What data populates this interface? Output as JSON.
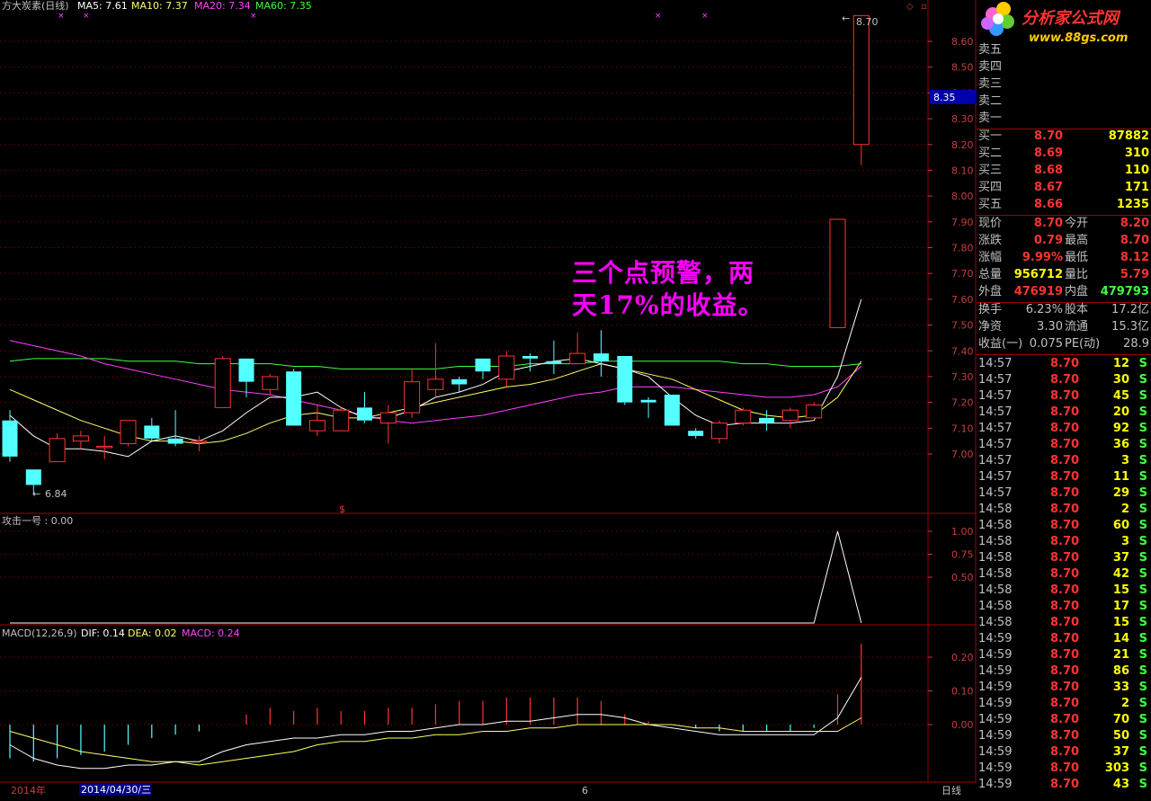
{
  "header": {
    "title": "方大炭素(日线)",
    "ma5": "MA5: 7.61",
    "ma10": "MA10: 7.37",
    "ma20": "MA20: 7.34",
    "ma60": "MA60: 7.35"
  },
  "colors": {
    "ma5": "#ffffff",
    "ma10": "#ffff66",
    "ma20": "#ff40ff",
    "ma60": "#40ff40",
    "up": "#ff3333",
    "down": "#54ffff",
    "grid": "#a00000",
    "axis": "#c04040",
    "annotation": "#ff00ff"
  },
  "price_axis": [
    "8.60",
    "8.50",
    "8.40",
    "8.30",
    "8.20",
    "8.10",
    "8.00",
    "7.90",
    "7.80",
    "7.70",
    "7.60",
    "7.50",
    "7.40",
    "7.30",
    "7.20",
    "7.10",
    "7.00"
  ],
  "current_price_box": "8.35",
  "high_label": "8.70",
  "low_label": "6.84",
  "annotation": {
    "line1": "三个点预警，两",
    "line2": "天17%的收益。"
  },
  "indicator": {
    "title": "攻击一号 : 0.00",
    "axis": [
      "1.00",
      "0.75",
      "0.50"
    ],
    "values": [
      0,
      0,
      0,
      0,
      0,
      0,
      0,
      0,
      0,
      0,
      0,
      0,
      0,
      0,
      0,
      0,
      0,
      0,
      0,
      0,
      0,
      0,
      0,
      0,
      0,
      0,
      0,
      0,
      0,
      0,
      0,
      0,
      0,
      0,
      0,
      1,
      0
    ]
  },
  "macd": {
    "title": "MACD(12,26,9)",
    "dif": "DIF: 0.14",
    "dea": "DEA: 0.02",
    "macd": "MACD: 0.24",
    "axis": [
      "0.20",
      "0.10",
      "0.00"
    ]
  },
  "bottom_bar": {
    "year": "2014年",
    "date": "2014/04/30/三",
    "month_mark": "6",
    "period": "日线"
  },
  "chart_data": {
    "type": "candlestick",
    "ylim": [
      6.8,
      8.75
    ],
    "candles": [
      {
        "o": 7.13,
        "h": 7.17,
        "l": 6.97,
        "c": 6.99
      },
      {
        "o": 6.94,
        "h": 6.94,
        "l": 6.84,
        "c": 6.88
      },
      {
        "o": 6.97,
        "h": 7.08,
        "l": 6.97,
        "c": 7.06
      },
      {
        "o": 7.05,
        "h": 7.09,
        "l": 7.02,
        "c": 7.07
      },
      {
        "o": 7.03,
        "h": 7.07,
        "l": 6.98,
        "c": 7.03
      },
      {
        "o": 7.04,
        "h": 7.13,
        "l": 7.03,
        "c": 7.13
      },
      {
        "o": 7.11,
        "h": 7.14,
        "l": 7.05,
        "c": 7.06
      },
      {
        "o": 7.06,
        "h": 7.17,
        "l": 7.03,
        "c": 7.04
      },
      {
        "o": 7.05,
        "h": 7.07,
        "l": 7.01,
        "c": 7.05
      },
      {
        "o": 7.18,
        "h": 7.38,
        "l": 7.18,
        "c": 7.37
      },
      {
        "o": 7.37,
        "h": 7.37,
        "l": 7.22,
        "c": 7.28
      },
      {
        "o": 7.25,
        "h": 7.31,
        "l": 7.23,
        "c": 7.3
      },
      {
        "o": 7.32,
        "h": 7.33,
        "l": 7.11,
        "c": 7.11
      },
      {
        "o": 7.09,
        "h": 7.19,
        "l": 7.07,
        "c": 7.13
      },
      {
        "o": 7.09,
        "h": 7.18,
        "l": 7.09,
        "c": 7.17
      },
      {
        "o": 7.18,
        "h": 7.24,
        "l": 7.12,
        "c": 7.13
      },
      {
        "o": 7.12,
        "h": 7.19,
        "l": 7.04,
        "c": 7.16
      },
      {
        "o": 7.16,
        "h": 7.33,
        "l": 7.14,
        "c": 7.28
      },
      {
        "o": 7.25,
        "h": 7.43,
        "l": 7.22,
        "c": 7.29
      },
      {
        "o": 7.29,
        "h": 7.3,
        "l": 7.24,
        "c": 7.27
      },
      {
        "o": 7.37,
        "h": 7.37,
        "l": 7.29,
        "c": 7.32
      },
      {
        "o": 7.29,
        "h": 7.4,
        "l": 7.26,
        "c": 7.38
      },
      {
        "o": 7.38,
        "h": 7.39,
        "l": 7.32,
        "c": 7.37
      },
      {
        "o": 7.36,
        "h": 7.44,
        "l": 7.31,
        "c": 7.35
      },
      {
        "o": 7.35,
        "h": 7.47,
        "l": 7.35,
        "c": 7.39
      },
      {
        "o": 7.39,
        "h": 7.48,
        "l": 7.3,
        "c": 7.36
      },
      {
        "o": 7.38,
        "h": 7.38,
        "l": 7.19,
        "c": 7.2
      },
      {
        "o": 7.21,
        "h": 7.22,
        "l": 7.14,
        "c": 7.2
      },
      {
        "o": 7.23,
        "h": 7.23,
        "l": 7.11,
        "c": 7.11
      },
      {
        "o": 7.09,
        "h": 7.1,
        "l": 7.06,
        "c": 7.07
      },
      {
        "o": 7.06,
        "h": 7.13,
        "l": 7.04,
        "c": 7.12
      },
      {
        "o": 7.12,
        "h": 7.18,
        "l": 7.11,
        "c": 7.17
      },
      {
        "o": 7.14,
        "h": 7.17,
        "l": 7.09,
        "c": 7.12
      },
      {
        "o": 7.13,
        "h": 7.18,
        "l": 7.1,
        "c": 7.17
      },
      {
        "o": 7.14,
        "h": 7.2,
        "l": 7.14,
        "c": 7.19
      },
      {
        "o": 7.49,
        "h": 7.91,
        "l": 7.49,
        "c": 7.91
      },
      {
        "o": 8.2,
        "h": 8.7,
        "l": 8.12,
        "c": 8.7
      }
    ],
    "ma5": [
      7.15,
      7.07,
      7.02,
      7.02,
      7.01,
      6.99,
      7.05,
      7.07,
      7.05,
      7.09,
      7.16,
      7.22,
      7.22,
      7.24,
      7.18,
      7.14,
      7.14,
      7.17,
      7.22,
      7.24,
      7.27,
      7.32,
      7.34,
      7.36,
      7.37,
      7.35,
      7.33,
      7.3,
      7.22,
      7.15,
      7.11,
      7.12,
      7.12,
      7.12,
      7.13,
      7.3,
      7.6
    ],
    "ma10": [
      7.25,
      7.21,
      7.17,
      7.13,
      7.1,
      7.07,
      7.05,
      7.05,
      7.04,
      7.05,
      7.08,
      7.12,
      7.15,
      7.16,
      7.14,
      7.14,
      7.16,
      7.18,
      7.2,
      7.22,
      7.24,
      7.26,
      7.27,
      7.29,
      7.32,
      7.35,
      7.33,
      7.31,
      7.29,
      7.25,
      7.21,
      7.17,
      7.15,
      7.14,
      7.15,
      7.22,
      7.36
    ],
    "ma20": [
      7.44,
      7.42,
      7.4,
      7.38,
      7.35,
      7.33,
      7.31,
      7.29,
      7.27,
      7.25,
      7.24,
      7.23,
      7.21,
      7.19,
      7.17,
      7.15,
      7.13,
      7.12,
      7.13,
      7.14,
      7.15,
      7.17,
      7.19,
      7.21,
      7.23,
      7.24,
      7.26,
      7.26,
      7.26,
      7.25,
      7.24,
      7.23,
      7.22,
      7.22,
      7.23,
      7.26,
      7.34
    ],
    "ma60": [
      7.36,
      7.37,
      7.37,
      7.37,
      7.37,
      7.36,
      7.36,
      7.36,
      7.35,
      7.35,
      7.35,
      7.35,
      7.34,
      7.34,
      7.33,
      7.33,
      7.33,
      7.33,
      7.33,
      7.34,
      7.34,
      7.34,
      7.35,
      7.35,
      7.35,
      7.36,
      7.36,
      7.36,
      7.36,
      7.36,
      7.36,
      7.35,
      7.35,
      7.34,
      7.34,
      7.34,
      7.35
    ],
    "macd_ylim": [
      -0.16,
      0.26
    ],
    "macd_bars": [
      -0.1,
      -0.11,
      -0.1,
      -0.09,
      -0.08,
      -0.06,
      -0.04,
      -0.03,
      -0.02,
      0.0,
      0.03,
      0.05,
      0.04,
      0.05,
      0.04,
      0.04,
      0.05,
      0.05,
      0.06,
      0.07,
      0.07,
      0.08,
      0.08,
      0.08,
      0.08,
      0.07,
      0.03,
      0.01,
      0.0,
      -0.01,
      -0.02,
      -0.02,
      -0.02,
      -0.02,
      -0.01,
      0.09,
      0.24
    ],
    "dif": [
      -0.06,
      -0.1,
      -0.12,
      -0.13,
      -0.13,
      -0.12,
      -0.12,
      -0.11,
      -0.11,
      -0.08,
      -0.06,
      -0.05,
      -0.04,
      -0.04,
      -0.03,
      -0.03,
      -0.02,
      -0.02,
      -0.01,
      0.0,
      0.0,
      0.01,
      0.01,
      0.02,
      0.03,
      0.03,
      0.02,
      0.0,
      -0.01,
      -0.02,
      -0.03,
      -0.03,
      -0.03,
      -0.03,
      -0.03,
      0.02,
      0.14
    ],
    "dea": [
      -0.02,
      -0.04,
      -0.06,
      -0.08,
      -0.09,
      -0.1,
      -0.11,
      -0.11,
      -0.12,
      -0.11,
      -0.1,
      -0.09,
      -0.08,
      -0.06,
      -0.05,
      -0.05,
      -0.04,
      -0.04,
      -0.03,
      -0.03,
      -0.02,
      -0.02,
      -0.01,
      -0.01,
      0.0,
      0.0,
      0.0,
      0.0,
      0.0,
      -0.01,
      -0.01,
      -0.02,
      -0.02,
      -0.02,
      -0.02,
      -0.02,
      0.02
    ]
  },
  "quote_panel": {
    "sells": [
      {
        "label": "卖五",
        "price": "",
        "vol": ""
      },
      {
        "label": "卖四",
        "price": "",
        "vol": ""
      },
      {
        "label": "卖三",
        "price": "",
        "vol": ""
      },
      {
        "label": "卖二",
        "price": "",
        "vol": ""
      },
      {
        "label": "卖一",
        "price": "",
        "vol": ""
      }
    ],
    "buys": [
      {
        "label": "买一",
        "price": "8.70",
        "vol": "87882"
      },
      {
        "label": "买二",
        "price": "8.69",
        "vol": "310"
      },
      {
        "label": "买三",
        "price": "8.68",
        "vol": "110"
      },
      {
        "label": "买四",
        "price": "8.67",
        "vol": "171"
      },
      {
        "label": "买五",
        "price": "8.66",
        "vol": "1235"
      }
    ],
    "stats": [
      {
        "l1": "现价",
        "v1": "8.70",
        "c1": "#ff3333",
        "l2": "今开",
        "v2": "8.20",
        "c2": "#ff3333"
      },
      {
        "l1": "涨跌",
        "v1": "0.79",
        "c1": "#ff3333",
        "l2": "最高",
        "v2": "8.70",
        "c2": "#ff3333"
      },
      {
        "l1": "涨幅",
        "v1": "9.99%",
        "c1": "#ff3333",
        "l2": "最低",
        "v2": "8.12",
        "c2": "#ff3333"
      },
      {
        "l1": "总量",
        "v1": "956712",
        "c1": "#ffff00",
        "l2": "量比",
        "v2": "5.79",
        "c2": "#ff3333"
      },
      {
        "l1": "外盘",
        "v1": "476919",
        "c1": "#ff3333",
        "l2": "内盘",
        "v2": "479793",
        "c2": "#40ff40"
      }
    ],
    "stats2": [
      {
        "l1": "换手",
        "v1": "6.23%",
        "l2": "股本",
        "v2": "17.2亿"
      },
      {
        "l1": "净资",
        "v1": "3.30",
        "l2": "流通",
        "v2": "15.3亿"
      },
      {
        "l1": "收益(一)",
        "v1": "0.075",
        "l2": "PE(动)",
        "v2": "28.9"
      }
    ],
    "ticks": [
      {
        "t": "14:57",
        "p": "8.70",
        "v": "12",
        "s": "S"
      },
      {
        "t": "14:57",
        "p": "8.70",
        "v": "30",
        "s": "S"
      },
      {
        "t": "14:57",
        "p": "8.70",
        "v": "45",
        "s": "S"
      },
      {
        "t": "14:57",
        "p": "8.70",
        "v": "20",
        "s": "S"
      },
      {
        "t": "14:57",
        "p": "8.70",
        "v": "92",
        "s": "S"
      },
      {
        "t": "14:57",
        "p": "8.70",
        "v": "36",
        "s": "S"
      },
      {
        "t": "14:57",
        "p": "8.70",
        "v": "3",
        "s": "S"
      },
      {
        "t": "14:57",
        "p": "8.70",
        "v": "11",
        "s": "S"
      },
      {
        "t": "14:57",
        "p": "8.70",
        "v": "29",
        "s": "S"
      },
      {
        "t": "14:58",
        "p": "8.70",
        "v": "2",
        "s": "S"
      },
      {
        "t": "14:58",
        "p": "8.70",
        "v": "60",
        "s": "S"
      },
      {
        "t": "14:58",
        "p": "8.70",
        "v": "3",
        "s": "S"
      },
      {
        "t": "14:58",
        "p": "8.70",
        "v": "37",
        "s": "S"
      },
      {
        "t": "14:58",
        "p": "8.70",
        "v": "42",
        "s": "S"
      },
      {
        "t": "14:58",
        "p": "8.70",
        "v": "15",
        "s": "S"
      },
      {
        "t": "14:58",
        "p": "8.70",
        "v": "17",
        "s": "S"
      },
      {
        "t": "14:58",
        "p": "8.70",
        "v": "15",
        "s": "S"
      },
      {
        "t": "14:59",
        "p": "8.70",
        "v": "14",
        "s": "S"
      },
      {
        "t": "14:59",
        "p": "8.70",
        "v": "21",
        "s": "S"
      },
      {
        "t": "14:59",
        "p": "8.70",
        "v": "86",
        "s": "S"
      },
      {
        "t": "14:59",
        "p": "8.70",
        "v": "33",
        "s": "S"
      },
      {
        "t": "14:59",
        "p": "8.70",
        "v": "2",
        "s": "S"
      },
      {
        "t": "14:59",
        "p": "8.70",
        "v": "70",
        "s": "S"
      },
      {
        "t": "14:59",
        "p": "8.70",
        "v": "50",
        "s": "S"
      },
      {
        "t": "14:59",
        "p": "8.70",
        "v": "37",
        "s": "S"
      },
      {
        "t": "14:59",
        "p": "8.70",
        "v": "303",
        "s": "S"
      },
      {
        "t": "14:59",
        "p": "8.70",
        "v": "43",
        "s": "S"
      }
    ]
  },
  "logo": {
    "text": "分析家公式网",
    "url": "www.88gs.com"
  }
}
